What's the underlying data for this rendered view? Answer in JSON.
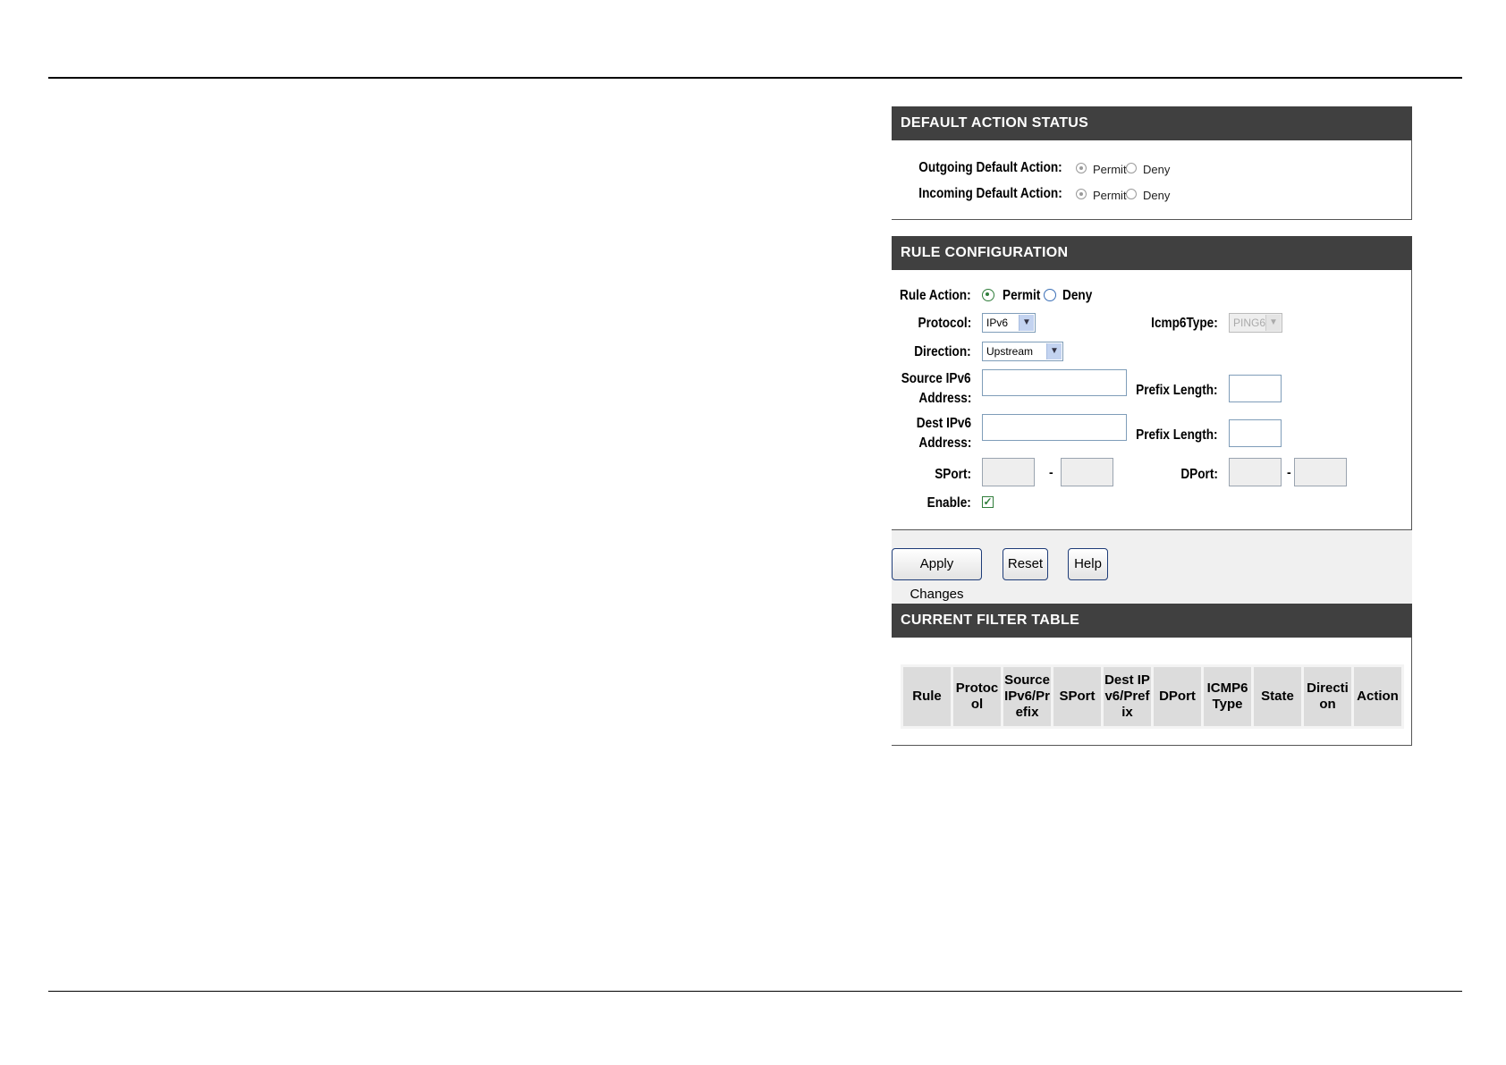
{
  "default_action_status": {
    "header": "DEFAULT ACTION STATUS",
    "outgoing_label": "Outgoing Default Action:",
    "incoming_label": "Incoming Default Action:",
    "permit_label": "Permit",
    "deny_label": "Deny",
    "outgoing_selected": "Permit",
    "incoming_selected": "Permit"
  },
  "rule_configuration": {
    "header": "RULE CONFIGURATION",
    "rule_action_label": "Rule Action:",
    "permit_label": "Permit",
    "deny_label": "Deny",
    "rule_action_selected": "Permit",
    "protocol_label": "Protocol:",
    "protocol_value": "IPv6",
    "icmp6type_label": "Icmp6Type:",
    "icmp6type_value": "PING6",
    "direction_label": "Direction:",
    "direction_value": "Upstream",
    "source_label_line1": "Source IPv6",
    "source_label_line2": "Address:",
    "dest_label_line1": "Dest IPv6",
    "dest_label_line2": "Address:",
    "prefix_length_label": "Prefix Length:",
    "sport_label": "SPort:",
    "dport_label": "DPort:",
    "dash": "-",
    "enable_label": "Enable:",
    "enable_checked": true
  },
  "buttons": {
    "apply": "Apply Changes",
    "reset": "Reset",
    "help": "Help"
  },
  "current_filter_table": {
    "header": "CURRENT FILTER TABLE",
    "columns": [
      "Rule",
      "Protocol",
      "Source IPv6/Prefix",
      "SPort",
      "Dest IPv6/Prefix",
      "DPort",
      "ICMP6Type",
      "State",
      "Direction",
      "Action"
    ]
  },
  "colors": {
    "header_bg": "#404040",
    "header_text": "#ffffff",
    "button_border": "#1e3c78"
  }
}
